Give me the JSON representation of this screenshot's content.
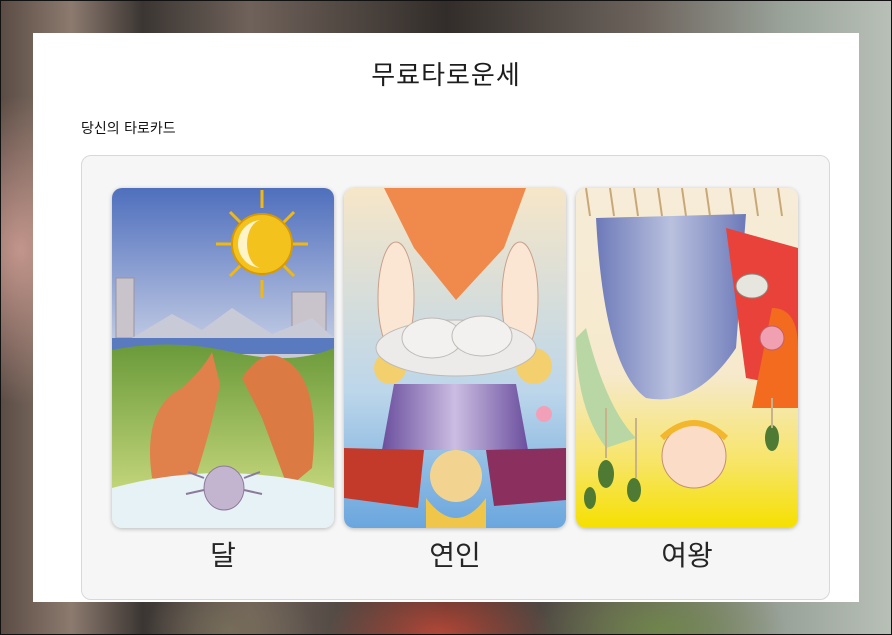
{
  "page": {
    "title": "무료타로운세",
    "subtitle": "당신의 타로카드"
  },
  "cards": [
    {
      "name": "달",
      "illustration": "moon-card-illustration",
      "orientation": "upright"
    },
    {
      "name": "연인",
      "illustration": "lovers-card-illustration",
      "orientation": "reversed"
    },
    {
      "name": "여왕",
      "illustration": "empress-card-illustration",
      "orientation": "reversed"
    }
  ]
}
